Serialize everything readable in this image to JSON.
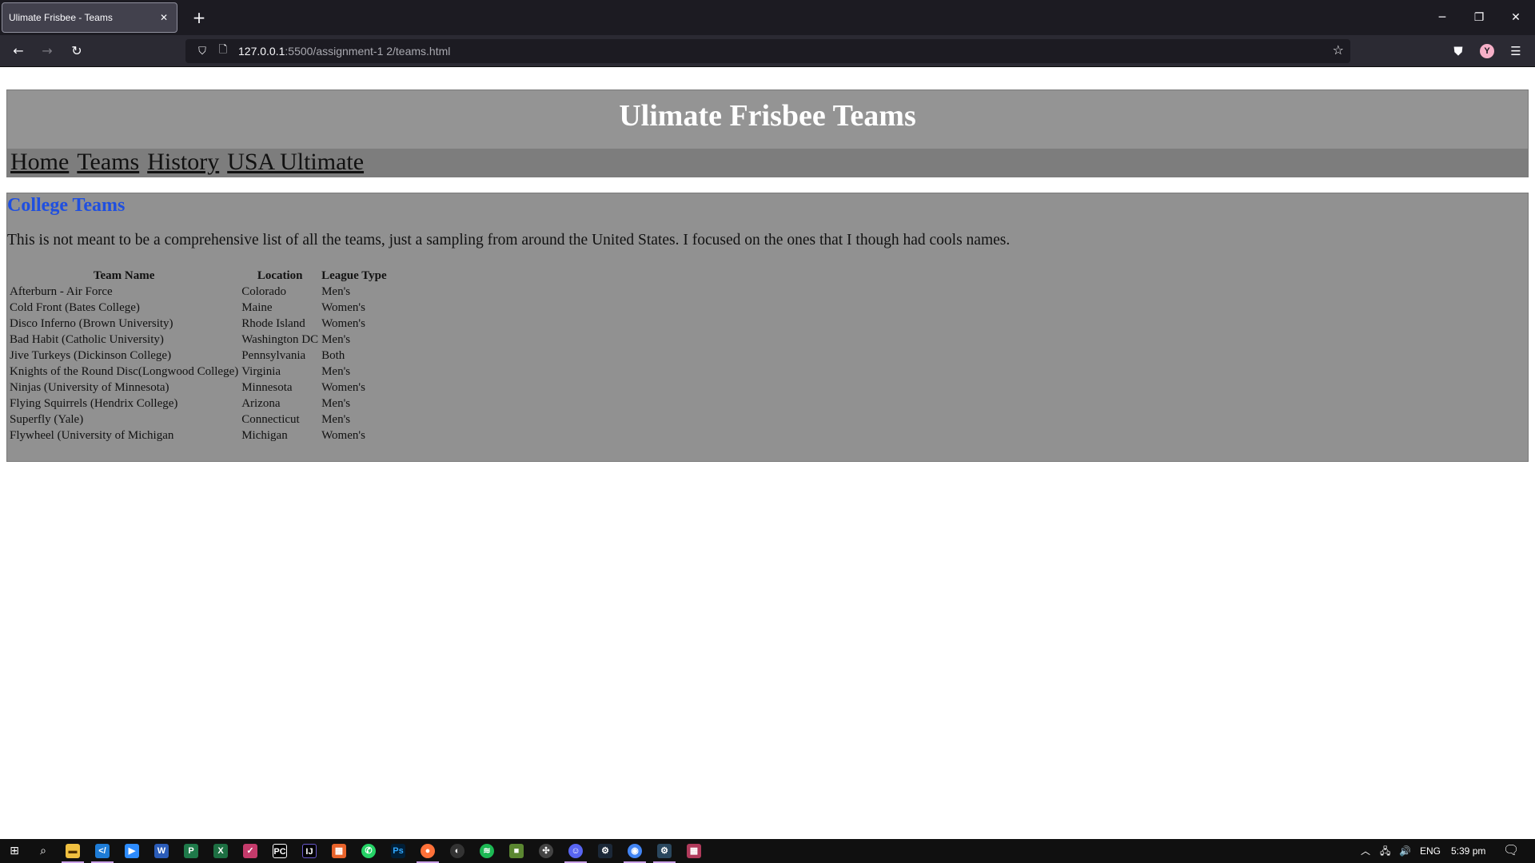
{
  "browser": {
    "tab_title": "Ulimate Frisbee - Teams",
    "tab_close": "✕",
    "new_tab": "+",
    "url_host": "127.0.0.1",
    "url_rest": ":5500/assignment-1 2/teams.html",
    "window_controls": {
      "minimize": "─",
      "restore": "❐",
      "close": "✕"
    },
    "icons": [
      "back-icon",
      "forward-icon",
      "reload-icon",
      "shield-icon",
      "page-icon",
      "star-icon",
      "pocket-icon",
      "account-icon",
      "menu-icon"
    ],
    "account_initial": "Y"
  },
  "site": {
    "title": "Ulimate Frisbee Teams",
    "nav": [
      "Home",
      "Teams",
      "History",
      "USA Ultimate"
    ]
  },
  "main": {
    "section_title": "College Teams",
    "intro": "This is not meant to be a comprehensive list of all the teams, just a sampling from around the United States. I focused on the ones that I though had cools names.",
    "table": {
      "headers": [
        "Team Name",
        "Location",
        "League Type"
      ],
      "rows": [
        [
          "Afterburn - Air Force",
          "Colorado",
          "Men's"
        ],
        [
          "Cold Front (Bates College)",
          "Maine",
          "Women's"
        ],
        [
          "Disco Inferno (Brown University)",
          "Rhode Island",
          "Women's"
        ],
        [
          "Bad Habit (Catholic University)",
          "Washington DC",
          "Men's"
        ],
        [
          "Jive Turkeys (Dickinson College)",
          "Pennsylvania",
          "Both"
        ],
        [
          "Knights of the Round Disc(Longwood College)",
          "Virginia",
          "Men's"
        ],
        [
          "Ninjas (University of Minnesota)",
          "Minnesota",
          "Women's"
        ],
        [
          "Flying Squirrels (Hendrix College)",
          "Arizona",
          "Men's"
        ],
        [
          "Superfly (Yale)",
          "Connecticut",
          "Men's"
        ],
        [
          "Flywheel (University of Michigan",
          "Michigan",
          "Women's"
        ]
      ]
    }
  },
  "taskbar": {
    "apps": [
      "start-icon",
      "search-icon",
      "file-explorer-icon",
      "vscode-icon",
      "zoom-icon",
      "word-icon",
      "project-icon",
      "excel-icon",
      "teams-icon",
      "pycharm-icon",
      "intellij-icon",
      "office-icon",
      "whatsapp-icon",
      "photoshop-icon",
      "firefox-icon",
      "github-icon",
      "spotify-icon",
      "minecraft-icon",
      "davinci-icon",
      "discord-icon",
      "steam-icon",
      "chrome-icon",
      "steam-alt-icon",
      "calendar-icon"
    ],
    "tray": {
      "lang": "ENG",
      "time": "5:39 pm"
    }
  },
  "colors": {
    "chrome_dark": "#1c1b22",
    "chrome_bar": "#2b2a33",
    "header_bg": "#949494",
    "nav_bg": "#7d7d7d",
    "content_bg": "#919191",
    "section_title": "#1f4fe0"
  }
}
